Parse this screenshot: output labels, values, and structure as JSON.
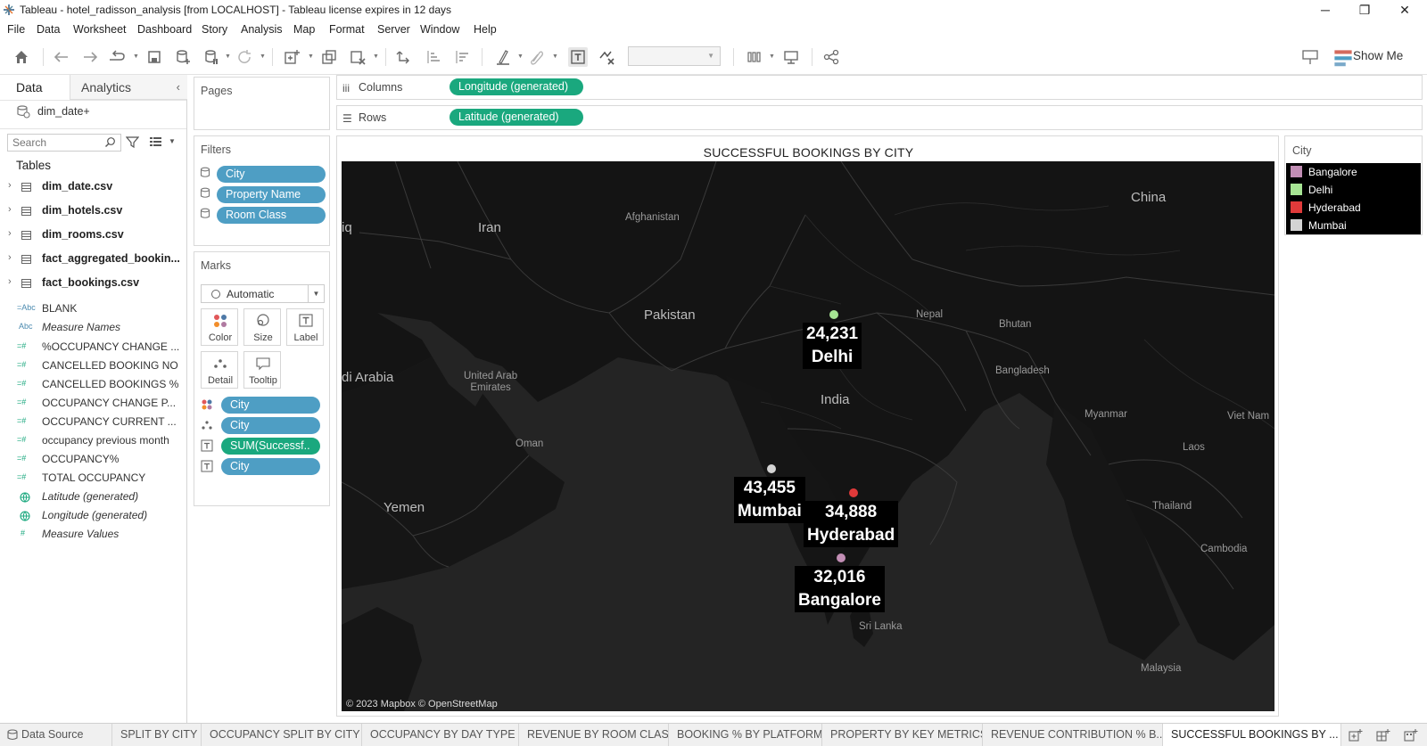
{
  "window": {
    "title": "Tableau - hotel_radisson_analysis [from LOCALHOST] - Tableau license expires in 12 days",
    "minimize": "─",
    "restore": "❐",
    "close": "✕"
  },
  "menu": [
    "File",
    "Data",
    "Worksheet",
    "Dashboard",
    "Story",
    "Analysis",
    "Map",
    "Format",
    "Server",
    "Window",
    "Help"
  ],
  "toolbar": {
    "show_me": "Show Me"
  },
  "data_pane": {
    "tab_data": "Data",
    "tab_analytics": "Analytics",
    "data_source": "dim_date+",
    "search_placeholder": "Search",
    "tables_header": "Tables",
    "tables": [
      "dim_date.csv",
      "dim_hotels.csv",
      "dim_rooms.csv",
      "fact_aggregated_bookin...",
      "fact_bookings.csv"
    ],
    "fields": [
      {
        "icon": "=Abc",
        "name": "BLANK",
        "italic": false
      },
      {
        "icon": "Abc",
        "name": "Measure Names",
        "italic": true
      },
      {
        "icon": "=#",
        "name": "%OCCUPANCY CHANGE ...",
        "italic": false
      },
      {
        "icon": "=#",
        "name": "CANCELLED BOOKING NO",
        "italic": false
      },
      {
        "icon": "=#",
        "name": "CANCELLED BOOKINGS %",
        "italic": false
      },
      {
        "icon": "=#",
        "name": "OCCUPANCY CHANGE P...",
        "italic": false
      },
      {
        "icon": "=#",
        "name": "OCCUPANCY CURRENT ...",
        "italic": false
      },
      {
        "icon": "=#",
        "name": "occupancy previous month",
        "italic": false
      },
      {
        "icon": "=#",
        "name": "OCCUPANCY%",
        "italic": false
      },
      {
        "icon": "=#",
        "name": "TOTAL OCCUPANCY",
        "italic": false
      },
      {
        "icon": "globe",
        "name": "Latitude (generated)",
        "italic": true
      },
      {
        "icon": "globe",
        "name": "Longitude (generated)",
        "italic": true
      },
      {
        "icon": "#",
        "name": "Measure Values",
        "italic": true
      }
    ]
  },
  "pages": {
    "title": "Pages"
  },
  "filters": {
    "title": "Filters",
    "items": [
      "City",
      "Property Name",
      "Room Class"
    ]
  },
  "marks": {
    "title": "Marks",
    "type": "Automatic",
    "buttons": [
      "Color",
      "Size",
      "Label",
      "Detail",
      "Tooltip"
    ],
    "encodings": [
      {
        "type": "color",
        "field": "City",
        "color": "blue"
      },
      {
        "type": "detail",
        "field": "City",
        "color": "blue"
      },
      {
        "type": "label",
        "field": "SUM(Successf..",
        "color": "green"
      },
      {
        "type": "label",
        "field": "City",
        "color": "blue"
      }
    ]
  },
  "shelves": {
    "columns_label": "Columns",
    "columns_pill": "Longitude (generated)",
    "rows_label": "Rows",
    "rows_pill": "Latitude (generated)"
  },
  "view": {
    "title": "SUCCESSFUL BOOKINGS BY CITY",
    "attribution": "© 2023 Mapbox © OpenStreetMap",
    "geo_labels": {
      "china": "China",
      "afghanistan": "Afghanistan",
      "iran": "Iran",
      "iraq": "iq",
      "pakistan": "Pakistan",
      "nepal": "Nepal",
      "bhutan": "Bhutan",
      "bangladesh": "Bangladesh",
      "india": "India",
      "saudi": "di Arabia",
      "uae": "United Arab\nEmirates",
      "oman": "Oman",
      "myanmar": "Myanmar",
      "vietnam": "Viet Nam",
      "laos": "Laos",
      "yemen": "Yemen",
      "thailand": "Thailand",
      "cambodia": "Cambodia",
      "srilanka": "Sri Lanka",
      "malaysia": "Malaysia"
    }
  },
  "chart_data": {
    "type": "map",
    "title": "SUCCESSFUL BOOKINGS BY CITY",
    "points": [
      {
        "city": "Delhi",
        "value": "24,231",
        "color": "#a6e493",
        "lon": 77.2,
        "lat": 28.6
      },
      {
        "city": "Mumbai",
        "value": "43,455",
        "color": "#d3d3d3",
        "lon": 72.9,
        "lat": 19.1
      },
      {
        "city": "Hyderabad",
        "value": "34,888",
        "color": "#e03a3a",
        "lon": 78.5,
        "lat": 17.4
      },
      {
        "city": "Bangalore",
        "value": "32,016",
        "color": "#c28eb5",
        "lon": 77.6,
        "lat": 12.97
      }
    ]
  },
  "legend": {
    "title": "City",
    "items": [
      {
        "label": "Bangalore",
        "color": "#c28eb5"
      },
      {
        "label": "Delhi",
        "color": "#a6e493"
      },
      {
        "label": "Hyderabad",
        "color": "#e03a3a"
      },
      {
        "label": "Mumbai",
        "color": "#d3d3d3"
      }
    ]
  },
  "sheet_tabs": {
    "data_source": "Data Source",
    "tabs": [
      "SPLIT BY CITY",
      "OCCUPANCY SPLIT BY CITY",
      "OCCUPANCY BY DAY TYPE",
      "REVENUE BY ROOM CLASS",
      "BOOKING % BY PLATFORM",
      "PROPERTY BY KEY METRICS",
      "REVENUE CONTRIBUTION % B...",
      "SUCCESSFUL BOOKINGS BY ..."
    ],
    "active": 7
  }
}
